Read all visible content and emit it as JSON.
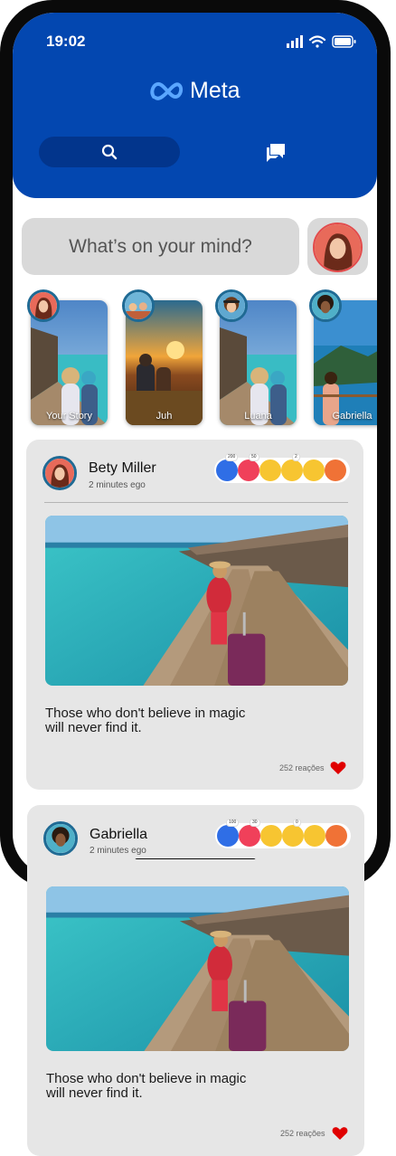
{
  "status_bar": {
    "time": "19:02"
  },
  "header": {
    "logo_text": "Meta"
  },
  "composer": {
    "placeholder": "What’s on your mind?"
  },
  "stories": [
    {
      "label": "Your Story"
    },
    {
      "label": "Juh"
    },
    {
      "label": "Luana"
    },
    {
      "label": "Gabriella"
    }
  ],
  "posts": [
    {
      "author": "Bety Miller",
      "time": "2 minutes ego",
      "reaction_counts": [
        "200",
        "50",
        "2"
      ],
      "caption": "Those who don't believe in magic\nwill never find it.",
      "likes": "252 reações"
    },
    {
      "author": "Gabriella",
      "time": "2 minutes ego",
      "reaction_counts": [
        "100",
        "30",
        "0"
      ],
      "caption": "Those who don't believe in magic\nwill never find it.",
      "likes": "252 reações"
    }
  ],
  "colors": {
    "brand_blue": "#0347b0",
    "card_gray": "#e6e6e6",
    "heart_red": "#e00000"
  },
  "icons": [
    "signal-icon",
    "wifi-icon",
    "battery-icon",
    "meta-logo-icon",
    "search-icon",
    "chat-icon",
    "heart-icon"
  ]
}
